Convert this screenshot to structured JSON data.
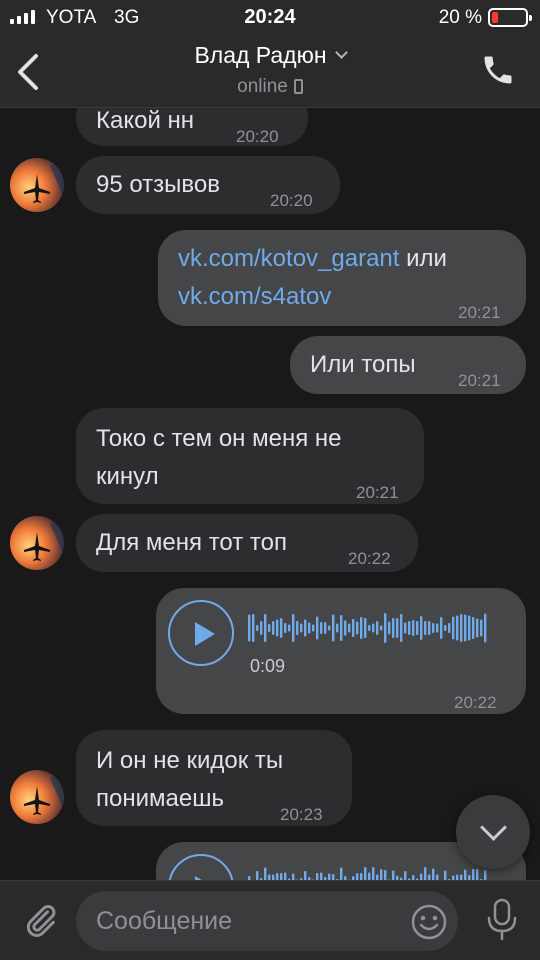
{
  "status_bar": {
    "carrier": "YOTA",
    "network": "3G",
    "time": "20:24",
    "battery_percent": "20 %",
    "battery_level": 0.2
  },
  "header": {
    "title": "Влад Радюн",
    "status": "online"
  },
  "messages": [
    {
      "direction": "in",
      "text": "Какой нн",
      "time": "20:20"
    },
    {
      "direction": "in",
      "text": "95 отзывов",
      "time": "20:20"
    },
    {
      "direction": "out",
      "link1": "vk.com/kotov_garant",
      "middle": " или",
      "link2": "vk.com/s4atov",
      "time": "20:21"
    },
    {
      "direction": "out",
      "text": "Или топы",
      "time": "20:21"
    },
    {
      "direction": "in",
      "line1": "Токо с тем он меня не",
      "line2": "кинул",
      "time": "20:21"
    },
    {
      "direction": "in",
      "text": "Для меня тот топ",
      "time": "20:22"
    },
    {
      "direction": "out",
      "type": "voice",
      "duration": "0:09",
      "time": "20:22"
    },
    {
      "direction": "in",
      "line1": "И он не кидок ты",
      "line2": "понимаешь",
      "time": "20:23"
    },
    {
      "direction": "out",
      "type": "voice"
    }
  ],
  "composer": {
    "placeholder": "Сообщение"
  },
  "colors": {
    "accent": "#71aaeb",
    "background": "#19191a",
    "incoming_bubble": "#2c2d2e",
    "outgoing_bubble": "#454647",
    "battery_low": "#ff3b30"
  },
  "icons": [
    "back-arrow-icon",
    "chevron-down-icon",
    "phone-icon",
    "mobile-device-icon",
    "play-icon",
    "paperclip-icon",
    "emoji-icon",
    "microphone-icon",
    "scroll-down-icon"
  ]
}
